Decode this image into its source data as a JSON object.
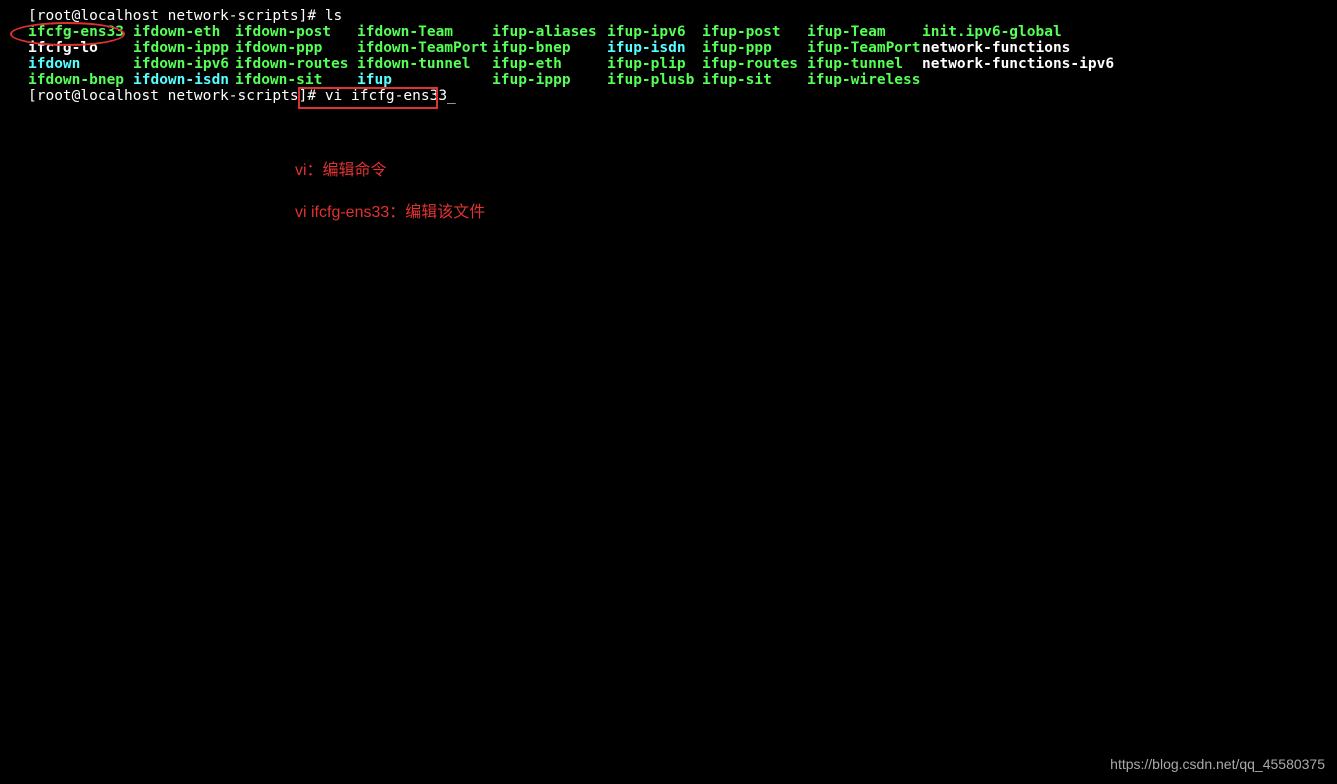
{
  "prompt1": {
    "user_host_path": "[root@localhost network-scripts]#",
    "command": "ls"
  },
  "listing": {
    "rows": [
      [
        {
          "text": "ifcfg-ens33",
          "cls": "fgreen"
        },
        {
          "text": "ifdown-eth",
          "cls": "fgreen"
        },
        {
          "text": "ifdown-post",
          "cls": "fgreen"
        },
        {
          "text": "ifdown-Team",
          "cls": "fgreen"
        },
        {
          "text": "ifup-aliases",
          "cls": "fgreen"
        },
        {
          "text": "ifup-ipv6",
          "cls": "fgreen"
        },
        {
          "text": "ifup-post",
          "cls": "fgreen"
        },
        {
          "text": "ifup-Team",
          "cls": "fgreen"
        },
        {
          "text": "init.ipv6-global",
          "cls": "fgreen"
        }
      ],
      [
        {
          "text": "ifcfg-lo",
          "cls": "fwhite"
        },
        {
          "text": "ifdown-ippp",
          "cls": "fgreen"
        },
        {
          "text": "ifdown-ppp",
          "cls": "fgreen"
        },
        {
          "text": "ifdown-TeamPort",
          "cls": "fgreen"
        },
        {
          "text": "ifup-bnep",
          "cls": "fgreen"
        },
        {
          "text": "ifup-isdn",
          "cls": "fcyan"
        },
        {
          "text": "ifup-ppp",
          "cls": "fgreen"
        },
        {
          "text": "ifup-TeamPort",
          "cls": "fgreen"
        },
        {
          "text": "network-functions",
          "cls": "fwhite"
        }
      ],
      [
        {
          "text": "ifdown",
          "cls": "fcyan"
        },
        {
          "text": "ifdown-ipv6",
          "cls": "fgreen"
        },
        {
          "text": "ifdown-routes",
          "cls": "fgreen"
        },
        {
          "text": "ifdown-tunnel",
          "cls": "fgreen"
        },
        {
          "text": "ifup-eth",
          "cls": "fgreen"
        },
        {
          "text": "ifup-plip",
          "cls": "fgreen"
        },
        {
          "text": "ifup-routes",
          "cls": "fgreen"
        },
        {
          "text": "ifup-tunnel",
          "cls": "fgreen"
        },
        {
          "text": "network-functions-ipv6",
          "cls": "fwhite"
        }
      ],
      [
        {
          "text": "ifdown-bnep",
          "cls": "fgreen"
        },
        {
          "text": "ifdown-isdn",
          "cls": "fcyan"
        },
        {
          "text": "ifdown-sit",
          "cls": "fgreen"
        },
        {
          "text": "ifup",
          "cls": "fcyan"
        },
        {
          "text": "ifup-ippp",
          "cls": "fgreen"
        },
        {
          "text": "ifup-plusb",
          "cls": "fgreen"
        },
        {
          "text": "ifup-sit",
          "cls": "fgreen"
        },
        {
          "text": "ifup-wireless",
          "cls": "fgreen"
        },
        {
          "text": "",
          "cls": "fwhite"
        }
      ]
    ]
  },
  "prompt2": {
    "user_host_path": "[root@localhost network-scripts]#",
    "command": "vi ifcfg-ens33",
    "cursor": "_"
  },
  "annotations": {
    "line1": "vi：编辑命令",
    "line2": "vi ifcfg-ens33：编辑该文件"
  },
  "watermark": "https://blog.csdn.net/qq_45580375"
}
